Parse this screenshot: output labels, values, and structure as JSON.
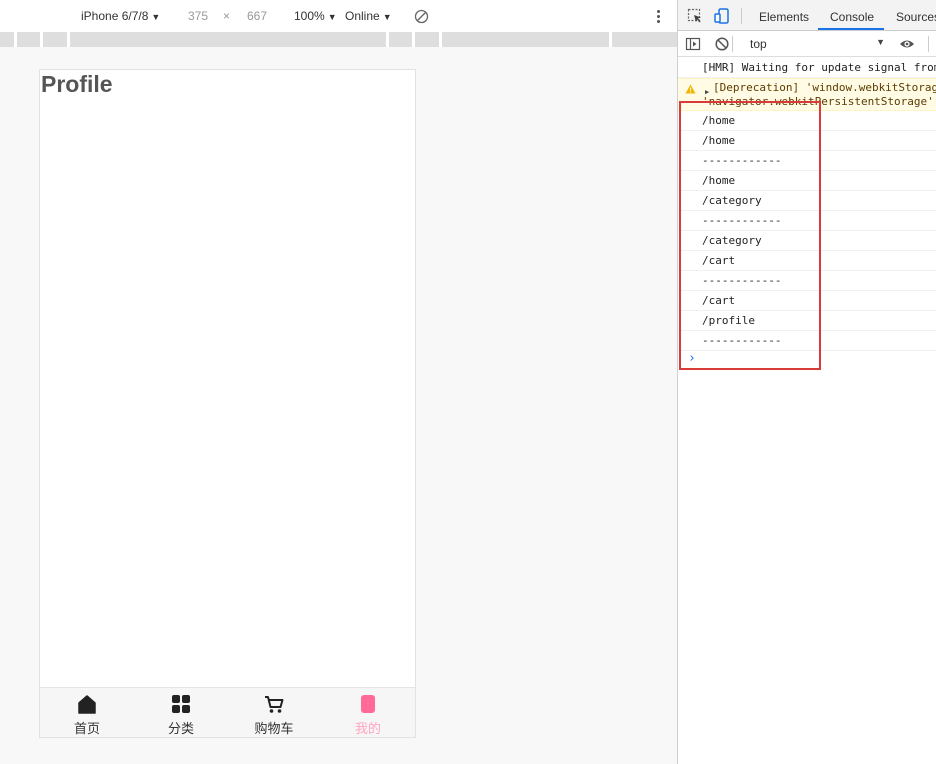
{
  "device_toolbar": {
    "device": "iPhone 6/7/8",
    "width": "375",
    "times": "×",
    "height": "667",
    "zoom": "100%",
    "network": "Online"
  },
  "app": {
    "page_title": "Profile",
    "tabbar": [
      {
        "label": "首页",
        "icon": "home-icon",
        "active": false
      },
      {
        "label": "分类",
        "icon": "category-icon",
        "active": false
      },
      {
        "label": "购物车",
        "icon": "cart-icon",
        "active": false
      },
      {
        "label": "我的",
        "icon": "profile-icon",
        "active": true
      }
    ],
    "active_color": "#ffa5bf"
  },
  "devtools": {
    "tabs": [
      "Elements",
      "Console",
      "Sources"
    ],
    "active_tab": "Console",
    "context": "top",
    "log": {
      "hmr": "[HMR] Waiting for update signal from",
      "warn_line1": "[Deprecation] 'window.webkitStorag",
      "warn_line2": "'navigator.webkitPersistentStorage'",
      "entries": [
        "/home",
        "/home",
        "------------",
        "/home",
        "/category",
        "------------",
        "/category",
        "/cart",
        "------------",
        "/cart",
        "/profile",
        "------------"
      ]
    },
    "prompt": "›",
    "highlight_color": "#d93a3a"
  }
}
